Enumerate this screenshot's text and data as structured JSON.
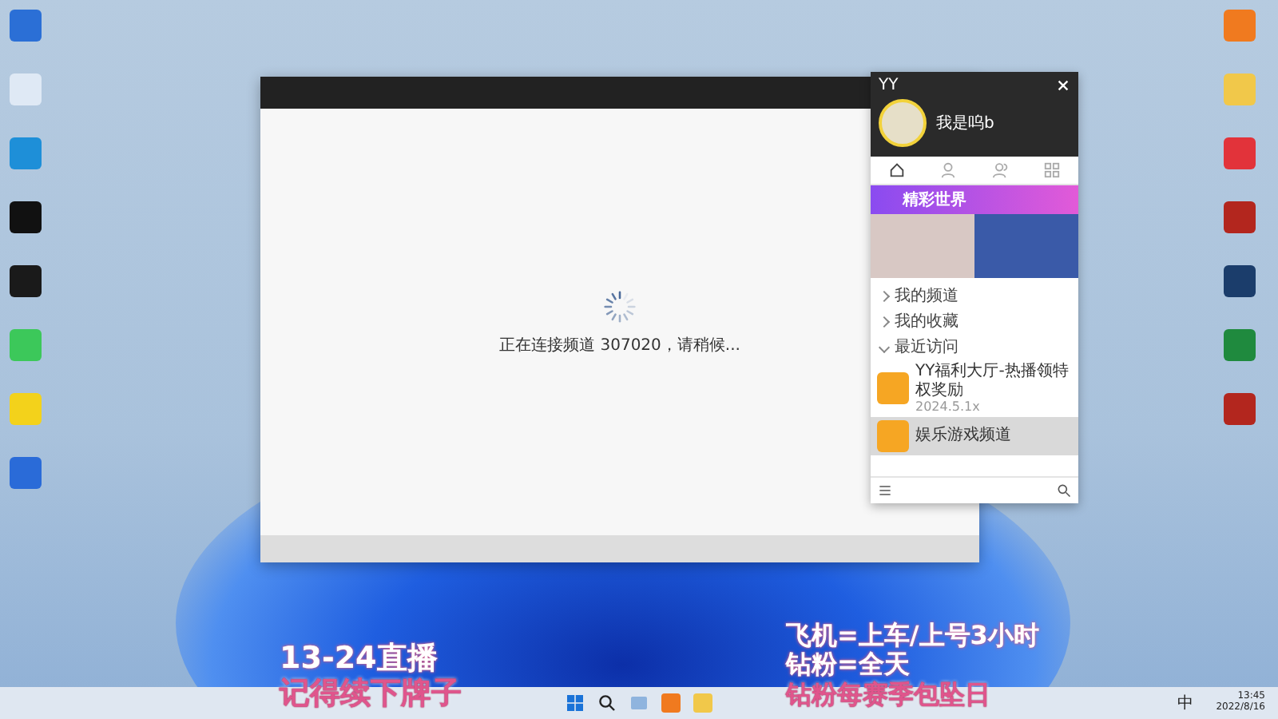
{
  "desktop_left": [
    {
      "kind": "tile"
    },
    {
      "kind": "recycle"
    },
    {
      "kind": "browser"
    },
    {
      "kind": "gpu"
    },
    {
      "kind": "video"
    },
    {
      "kind": "chat"
    },
    {
      "kind": "music"
    },
    {
      "kind": "game"
    }
  ],
  "desktop_right": [
    {
      "kind": "orange"
    },
    {
      "kind": "yellow"
    },
    {
      "kind": "red"
    },
    {
      "kind": "ship"
    },
    {
      "kind": "steam"
    },
    {
      "kind": "green"
    },
    {
      "kind": "ship"
    }
  ],
  "main_window": {
    "loading_text": "正在连接频道 307020，请稍候..."
  },
  "yy_panel": {
    "title": "YY",
    "username": "我是呜b",
    "tabs": [
      {
        "kind": "home",
        "selected": true
      },
      {
        "kind": "person",
        "selected": false
      },
      {
        "kind": "people",
        "selected": false
      },
      {
        "kind": "grid",
        "selected": false
      }
    ],
    "banner": "精彩世界",
    "sections": [
      {
        "label": "我的频道",
        "expanded": false
      },
      {
        "label": "我的收藏",
        "expanded": false
      },
      {
        "label": "最近访问",
        "expanded": true
      }
    ],
    "recent": [
      {
        "name": "YY福利大厅-热播领特权奖励",
        "meta": "2024.5.1x",
        "selected": false
      },
      {
        "name": "娱乐游戏频道",
        "selected": true
      }
    ]
  },
  "overlay": {
    "left": [
      "13-24直播",
      "记得续下牌子"
    ],
    "right": [
      "飞机=上车/上号3小时",
      "钻粉=全天",
      "钻粉每赛季包坠日"
    ]
  },
  "taskbar": {
    "apps": [
      {
        "kind": "start"
      },
      {
        "kind": "search"
      },
      {
        "kind": "gallery"
      },
      {
        "kind": "orange"
      },
      {
        "kind": "yellow"
      }
    ],
    "ime": "中",
    "time": "13:45",
    "date": "2022/8/16"
  }
}
